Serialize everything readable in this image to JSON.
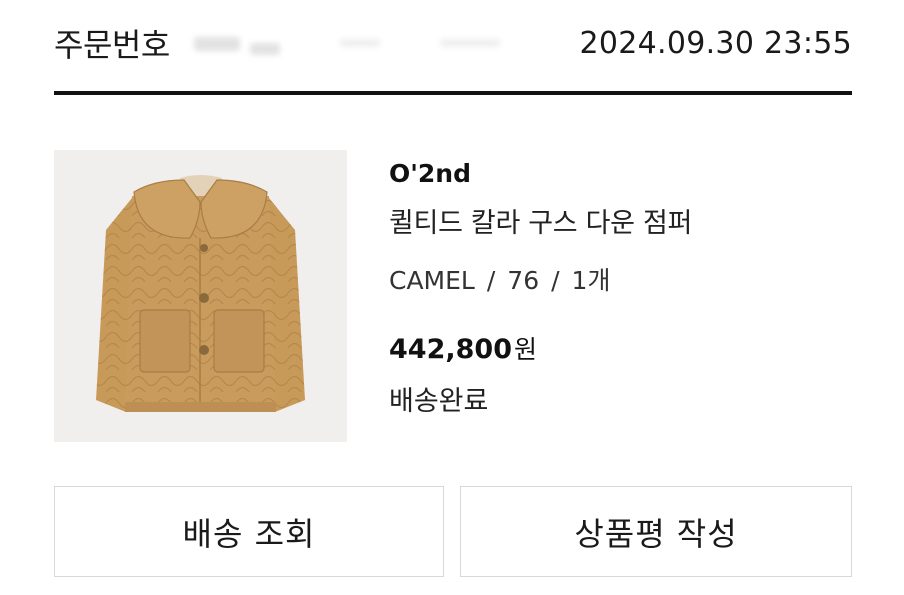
{
  "order": {
    "label": "주문번호",
    "date": "2024.09.30 23:55"
  },
  "product": {
    "brand": "O'2nd",
    "name": "퀼티드 칼라 구스 다운 점퍼",
    "color": "CAMEL",
    "size": "76",
    "quantity": "1개",
    "separator": "/",
    "price": "442,800",
    "price_unit": "원",
    "status": "배송완료",
    "image_icon": "camel-quilted-jacket-image"
  },
  "actions": {
    "track_label": "배송 조회",
    "review_label": "상품평 작성"
  },
  "colors": {
    "accent_line": "#111111",
    "button_border": "#d8d8d8",
    "jacket": "#c89a5a",
    "image_bg": "#f0efee"
  }
}
